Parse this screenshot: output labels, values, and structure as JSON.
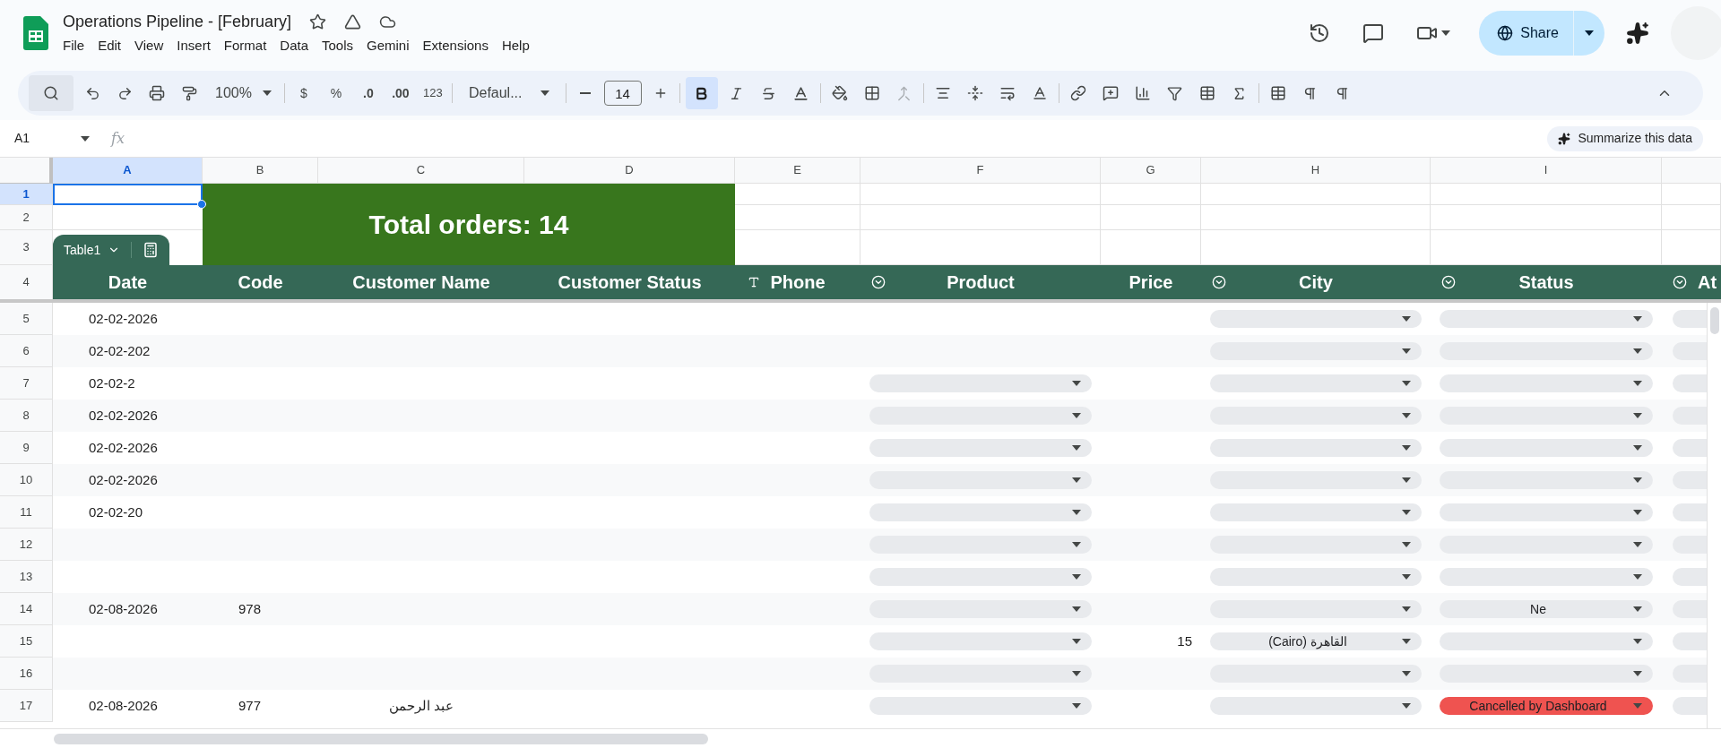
{
  "app": {
    "title": "Operations Pipeline - [February]",
    "menu": [
      "File",
      "Edit",
      "View",
      "Insert",
      "Format",
      "Data",
      "Tools",
      "Gemini",
      "Extensions",
      "Help"
    ],
    "share": "Share"
  },
  "toolbar": {
    "zoom": "100%",
    "currency": "$",
    "percent": "%",
    "decrease_decimals": ".0",
    "increase_decimals": ".00",
    "number_format": "123",
    "font": "Defaul...",
    "font_size": "14",
    "bold": true
  },
  "formula_bar": {
    "cell_ref": "A1",
    "fx": "fx",
    "summarize": "Summarize this data"
  },
  "columns": [
    {
      "label": "A",
      "selected": true
    },
    {
      "label": "B",
      "selected": false
    },
    {
      "label": "C",
      "selected": false
    },
    {
      "label": "D",
      "selected": false
    },
    {
      "label": "E",
      "selected": false
    },
    {
      "label": "F",
      "selected": false
    },
    {
      "label": "G",
      "selected": false
    },
    {
      "label": "H",
      "selected": false
    },
    {
      "label": "I",
      "selected": false
    }
  ],
  "top_rows": [
    {
      "label": "1",
      "selected": true
    },
    {
      "label": "2",
      "selected": false
    },
    {
      "label": "3",
      "selected": false
    },
    {
      "label": "4",
      "selected": false
    }
  ],
  "banner": {
    "text": "Total orders: 14"
  },
  "table": {
    "name": "Table1",
    "headers": [
      {
        "label": "Date",
        "kind": "plain"
      },
      {
        "label": "Code",
        "kind": "plain"
      },
      {
        "label": "Customer Name",
        "kind": "plain"
      },
      {
        "label": "Customer Status",
        "kind": "plain"
      },
      {
        "label": "Phone",
        "kind": "text"
      },
      {
        "label": "Product",
        "kind": "dropdown"
      },
      {
        "label": "Price",
        "kind": "plain"
      },
      {
        "label": "City",
        "kind": "dropdown"
      },
      {
        "label": "Status",
        "kind": "dropdown"
      },
      {
        "label": "At",
        "kind": "dropdown"
      }
    ]
  },
  "rows": [
    {
      "number": "5",
      "date": "02-02-2026",
      "product_dropdown": false,
      "status": {
        "color": "#e8eaed"
      }
    },
    {
      "number": "6",
      "date": "02-02-202",
      "product_dropdown": false,
      "status": {
        "color": "#e8eaed"
      }
    },
    {
      "number": "7",
      "date": "02-02-2",
      "product_dropdown": true,
      "status": {
        "color": "#e8eaed"
      }
    },
    {
      "number": "8",
      "date": "02-02-2026",
      "product_dropdown": true,
      "status": {
        "color": "#e8eaed"
      }
    },
    {
      "number": "9",
      "date": "02-02-2026",
      "product_dropdown": true,
      "status": {
        "color": "#e8eaed"
      }
    },
    {
      "number": "10",
      "date": "02-02-2026",
      "product_dropdown": true,
      "status": {
        "color": "#e8eaed"
      }
    },
    {
      "number": "11",
      "date": "02-02-20",
      "product_dropdown": true,
      "status": {
        "color": "#e8eaed"
      }
    },
    {
      "number": "12",
      "product_dropdown": true,
      "status": {
        "color": "#e8eaed"
      }
    },
    {
      "number": "13",
      "product_dropdown": true,
      "status": {
        "color": "#e8eaed"
      }
    },
    {
      "number": "14",
      "date": "02-08-2026",
      "code": "978",
      "product_dropdown": true,
      "status": {
        "text": "Ne",
        "color": "#e8eaed"
      }
    },
    {
      "number": "15",
      "price": "15",
      "city": "(Cairo) القاهرة",
      "product_dropdown": true,
      "status": {
        "color": "#e8eaed"
      }
    },
    {
      "number": "16",
      "product_dropdown": true,
      "status": {
        "color": "#e8eaed"
      }
    },
    {
      "number": "17",
      "date": "02-08-2026",
      "code": "977",
      "name": "عبد الرحمن",
      "product_dropdown": true,
      "status": {
        "text": "Cancelled by Dashboard",
        "color": "#ef5350"
      }
    }
  ]
}
